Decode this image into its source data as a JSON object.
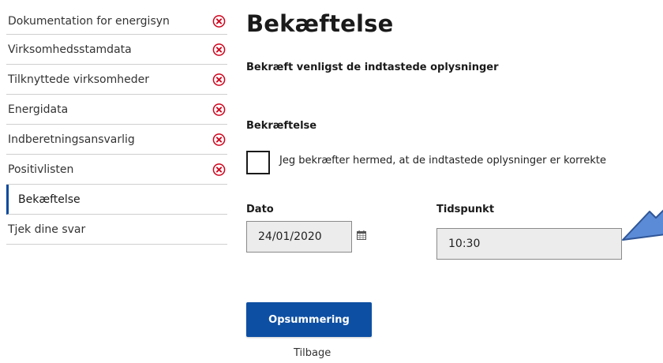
{
  "sidebar": {
    "items": [
      {
        "label": "Dokumentation for energisyn",
        "status": "error"
      },
      {
        "label": "Virksomhedsstamdata",
        "status": "error"
      },
      {
        "label": "Tilknyttede virksomheder",
        "status": "error"
      },
      {
        "label": "Energidata",
        "status": "error"
      },
      {
        "label": "Indberetningsansvarlig",
        "status": "error"
      },
      {
        "label": "Positivlisten",
        "status": "error"
      },
      {
        "label": "Bekæftelse",
        "status": "active"
      },
      {
        "label": "Tjek dine svar",
        "status": "none"
      }
    ]
  },
  "main": {
    "title": "Bekæftelse",
    "instruction": "Bekræft venligst de indtastede oplysninger",
    "section_label": "Bekræftelse",
    "checkbox": {
      "label": "Jeg bekræfter hermed, at de indtastede oplysninger er korrekte",
      "checked": false
    },
    "date": {
      "label": "Dato",
      "value": "24/01/2020"
    },
    "time": {
      "label": "Tidspunkt",
      "value": "10:30"
    },
    "primary_button": "Opsummering",
    "back_link": "Tilbage"
  },
  "icons": {
    "error": "circle-x-icon",
    "calendar": "calendar-icon",
    "callout": "arrow-pointer"
  },
  "colors": {
    "primary": "#0d4fa3",
    "error": "#d0021b",
    "active_bar": "#0a4a9c",
    "arrow_fill": "#5b8bd6",
    "arrow_stroke": "#2f5597"
  }
}
